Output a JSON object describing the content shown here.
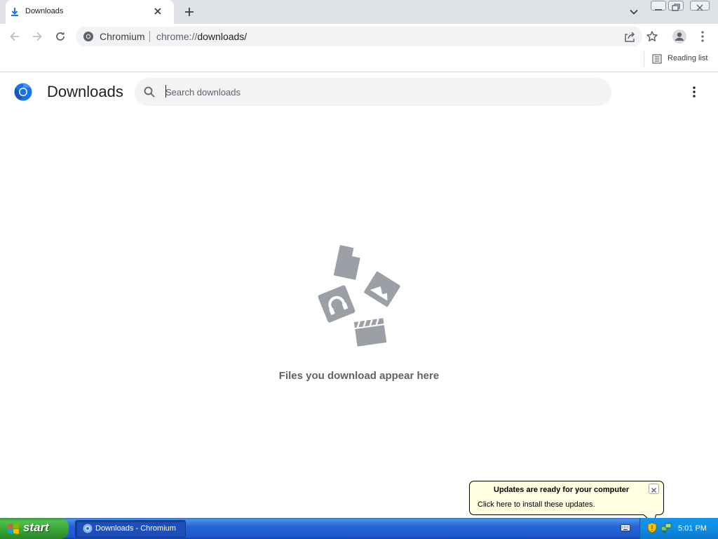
{
  "browser": {
    "tab": {
      "title": "Downloads",
      "icon": "download-icon"
    },
    "window_controls": [
      "minimize-icon",
      "restore-icon",
      "close-icon"
    ],
    "toolbar": {
      "site_name": "Chromium",
      "url_scheme": "chrome://",
      "url_host": "downloads/"
    },
    "bookmarks_bar": {
      "reading_list_label": "Reading list"
    }
  },
  "page": {
    "title": "Downloads",
    "search": {
      "placeholder": "Search downloads",
      "value": ""
    },
    "empty_message": "Files you download appear here"
  },
  "notification": {
    "title": "Updates are ready for your computer",
    "text": "Click here to install these updates."
  },
  "taskbar": {
    "start_label": "start",
    "task_label": "Downloads - Chromium",
    "clock": "5:01 PM"
  },
  "colors": {
    "accent": "#1a73e8",
    "tabstrip": "#dee1e6",
    "omnibox": "#f1f3f4",
    "illustration": "#9aa0a6",
    "taskbar": "#245edb",
    "start": "#3c9b3c",
    "balloon": "#ffffe1"
  }
}
